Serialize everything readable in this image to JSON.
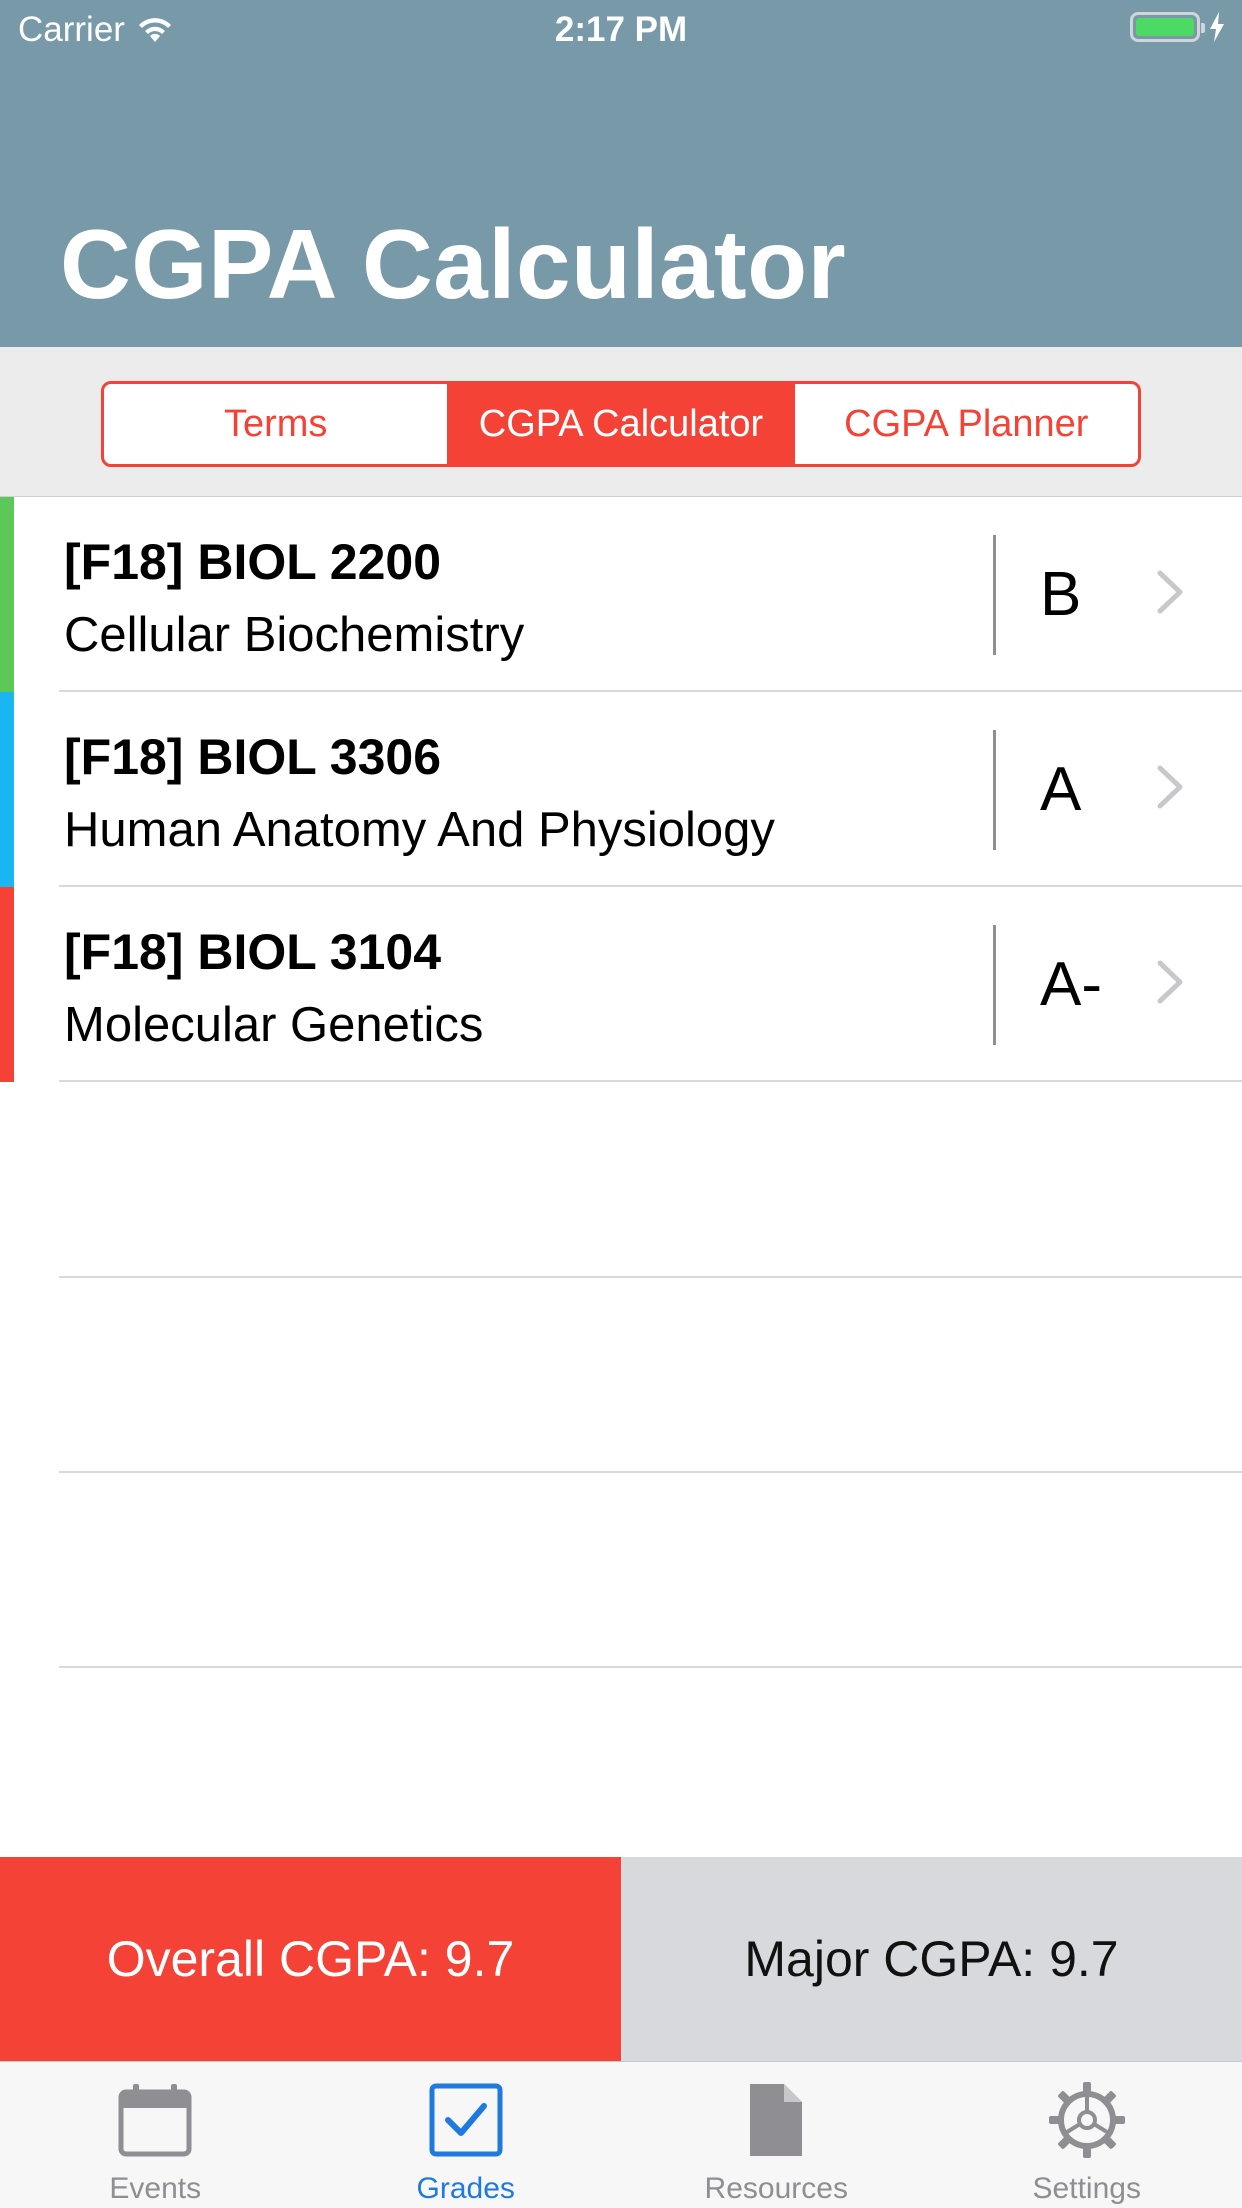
{
  "status_bar": {
    "carrier": "Carrier",
    "time": "2:17 PM"
  },
  "header": {
    "title": "CGPA Calculator"
  },
  "segments": [
    {
      "label": "Terms",
      "active": false
    },
    {
      "label": "CGPA Calculator",
      "active": true
    },
    {
      "label": "CGPA Planner",
      "active": false
    }
  ],
  "courses": [
    {
      "code": "[F18] BIOL 2200",
      "name": "Cellular Biochemistry",
      "grade": "B",
      "color": "#5cc85a"
    },
    {
      "code": "[F18] BIOL 3306",
      "name": "Human Anatomy And Physiology",
      "grade": "A",
      "color": "#1ab6f2"
    },
    {
      "code": "[F18] BIOL 3104",
      "name": "Molecular Genetics",
      "grade": "A-",
      "color": "#f44336"
    }
  ],
  "summary": {
    "overall": "Overall CGPA: 9.7",
    "major": "Major CGPA: 9.7"
  },
  "tabs": [
    {
      "label": "Events",
      "icon": "calendar-icon",
      "active": false
    },
    {
      "label": "Grades",
      "icon": "checkbox-icon",
      "active": true
    },
    {
      "label": "Resources",
      "icon": "document-icon",
      "active": false
    },
    {
      "label": "Settings",
      "icon": "gear-icon",
      "active": false
    }
  ],
  "colors": {
    "accent": "#f44336",
    "header": "#7799a8",
    "tab_active": "#1f7ae0"
  }
}
